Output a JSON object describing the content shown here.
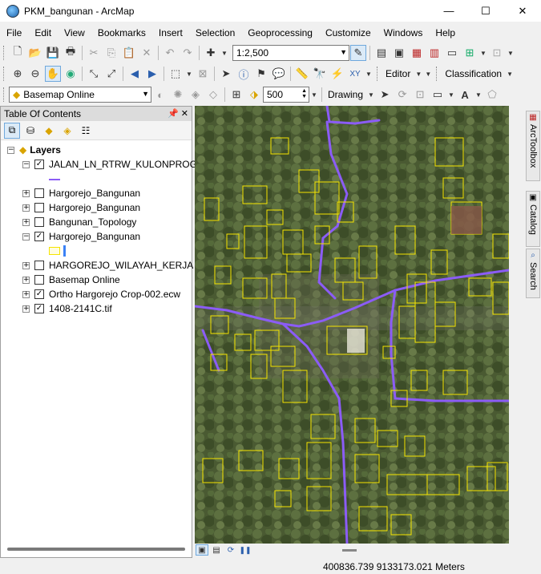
{
  "window": {
    "title": "PKM_bangunan - ArcMap",
    "minimize": "—",
    "maximize": "☐",
    "close": "✕"
  },
  "menu": [
    "File",
    "Edit",
    "View",
    "Bookmarks",
    "Insert",
    "Selection",
    "Geoprocessing",
    "Customize",
    "Windows",
    "Help"
  ],
  "toolbar": {
    "scale_value": "1:2,500",
    "editor_label": "Editor",
    "classification_label": "Classification",
    "basemap_value": "Basemap Online",
    "count_value": "500",
    "drawing_label": "Drawing"
  },
  "toc": {
    "title": "Table Of Contents",
    "root_label": "Layers",
    "layers": [
      {
        "label": "JALAN_LN_RTRW_KULONPROGO",
        "checked": true,
        "expanded": true
      },
      {
        "label": "Hargorejo_Bangunan",
        "checked": false,
        "expanded": false
      },
      {
        "label": "Hargorejo_Bangunan",
        "checked": false,
        "expanded": false
      },
      {
        "label": "Bangunan_Topology",
        "checked": false,
        "expanded": false
      },
      {
        "label": "Hargorejo_Bangunan",
        "checked": true,
        "expanded": true
      },
      {
        "label": "HARGOREJO_WILAYAH_KERJA",
        "checked": false,
        "expanded": false
      },
      {
        "label": "Basemap Online",
        "checked": false,
        "expanded": false
      },
      {
        "label": "Ortho Hargorejo Crop-002.ecw",
        "checked": true,
        "expanded": false
      },
      {
        "label": "1408-2141C.tif",
        "checked": true,
        "expanded": false
      }
    ]
  },
  "dock_tabs": [
    "ArcToolbox",
    "Catalog",
    "Search"
  ],
  "status": {
    "coordinates": "400836.739  9133173.021 Meters"
  },
  "colors": {
    "road": "#8b5cf6",
    "building_outline": "#f5e400",
    "highlight": "#3b82f6"
  }
}
